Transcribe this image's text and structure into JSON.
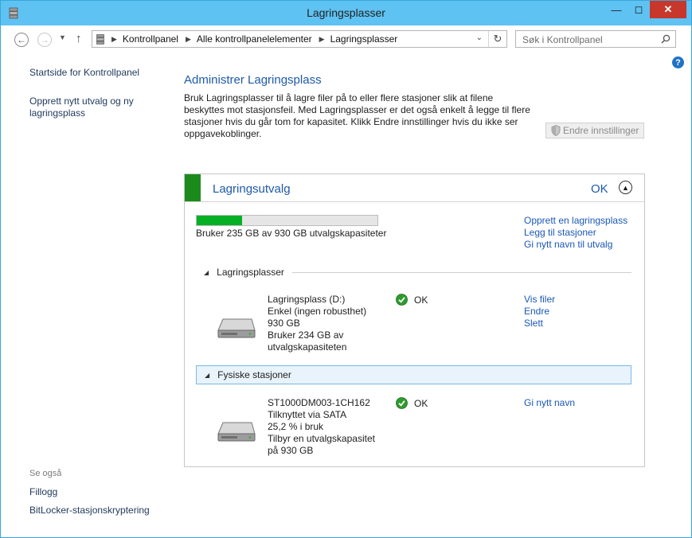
{
  "window": {
    "title": "Lagringsplasser"
  },
  "navbar": {
    "breadcrumbs": [
      "Kontrollpanel",
      "Alle kontrollpanelelementer",
      "Lagringsplasser"
    ],
    "search_placeholder": "Søk i Kontrollpanel"
  },
  "sidebar": {
    "links": [
      "Startside for Kontrollpanel",
      "Opprett nytt utvalg og ny lagringsplass"
    ],
    "see_also_label": "Se også",
    "see_also_links": [
      "Fillogg",
      "BitLocker-stasjonskryptering"
    ]
  },
  "main": {
    "title": "Administrer Lagringsplass",
    "description": "Bruk Lagringsplasser til å lagre filer på to eller flere stasjoner slik at filene beskyttes mot stasjonsfeil. Med Lagringsplasser er det også enkelt å legge til flere stasjoner hvis du går tom for kapasitet. Klikk Endre innstillinger hvis du ikke ser oppgavekoblinger.",
    "change_settings_label": "Endre innstillinger"
  },
  "pool": {
    "title": "Lagringsutvalg",
    "status": "OK",
    "usage_fraction": 0.253,
    "usage_text": "Bruker 235 GB av 930 GB utvalgskapasiteter",
    "actions": [
      "Opprett en lagringsplass",
      "Legg til stasjoner",
      "Gi nytt navn til utvalg"
    ],
    "spaces_section": "Lagringsplasser",
    "space": {
      "lines": [
        "Lagringsplass (D:)",
        "Enkel (ingen robusthet)",
        "930 GB",
        "Bruker 234 GB av",
        "utvalgskapasiteten"
      ],
      "status": "OK",
      "links": [
        "Vis filer",
        "Endre",
        "Slett"
      ]
    },
    "drives_section": "Fysiske stasjoner",
    "drive": {
      "lines": [
        "ST1000DM003-1CH162",
        "Tilknyttet via SATA",
        "25,2 % i bruk",
        "Tilbyr en utvalgskapasitet",
        "på 930 GB"
      ],
      "status": "OK",
      "links": [
        "Gi nytt navn"
      ]
    }
  },
  "icons": {
    "app": "storage-spaces-icon",
    "search": "search-icon",
    "help": "help-icon",
    "drive": "hard-drive-icon",
    "status_ok": "green-check-icon",
    "shield": "uac-shield-icon"
  },
  "colors": {
    "titlebar": "#5ec2f3",
    "close": "#c7372b",
    "link": "#1a58b7",
    "heading": "#1e5aa8",
    "pool_ok_bar": "#1b8a1b",
    "progress_fill": "#06b025"
  }
}
